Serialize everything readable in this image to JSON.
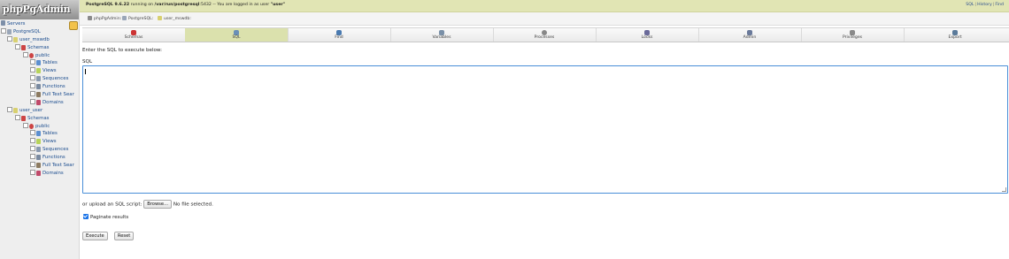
{
  "app": {
    "logo_text": "phpPgAdmin"
  },
  "sidebar": {
    "servers_label": "Servers",
    "server_label": "PostgreSQL",
    "databases": [
      {
        "name": "user_mswdb",
        "schemas_label": "Schemas",
        "schema_name": "public",
        "items": [
          "Tables",
          "Views",
          "Sequences",
          "Functions",
          "Full Text Sear",
          "Domains"
        ]
      },
      {
        "name": "user_user",
        "schemas_label": "Schemas",
        "schema_name": "public",
        "items": [
          "Tables",
          "Views",
          "Sequences",
          "Functions",
          "Full Text Sear",
          "Domains"
        ]
      }
    ]
  },
  "topbar": {
    "product": "PostgreSQL 9.6.22",
    "running_on": " running on ",
    "socket": "/var/run/postgresql",
    "port_text": ":5432 -- You are logged in as user ",
    "user": "\"user\"",
    "links": [
      "SQL",
      "History",
      "Find"
    ]
  },
  "breadcrumb": [
    "phpPgAdmin",
    "PostgreSQL",
    "user_mswdb"
  ],
  "tabs": [
    {
      "label": "Schemas",
      "active": false,
      "color": "#cc3333"
    },
    {
      "label": "SQL",
      "active": true,
      "color": "#6a8fb8"
    },
    {
      "label": "Find",
      "active": false,
      "color": "#4a7ab0"
    },
    {
      "label": "Variables",
      "active": false,
      "color": "#7a90a8"
    },
    {
      "label": "Processes",
      "active": false,
      "color": "#888888"
    },
    {
      "label": "Locks",
      "active": false,
      "color": "#6a6a9a"
    },
    {
      "label": "Admin",
      "active": false,
      "color": "#6a7a9a"
    },
    {
      "label": "Privileges",
      "active": false,
      "color": "#8a8a8a"
    },
    {
      "label": "Export",
      "active": false,
      "color": "#5a7a9a"
    }
  ],
  "content": {
    "instruction": "Enter the SQL to execute below:",
    "sql_label": "SQL",
    "sql_value": "",
    "upload_label": "or upload an SQL script:",
    "browse_label": "Browse...",
    "file_status": "No file selected.",
    "paginate_label": "Paginate results",
    "paginate_checked": true,
    "execute_label": "Execute",
    "reset_label": "Reset"
  },
  "colors": {
    "topbar_bg": "#e1e5b4",
    "active_tab": "#dbe1ad",
    "link": "#1a4c8e",
    "focus_border": "#4a8fd8"
  }
}
